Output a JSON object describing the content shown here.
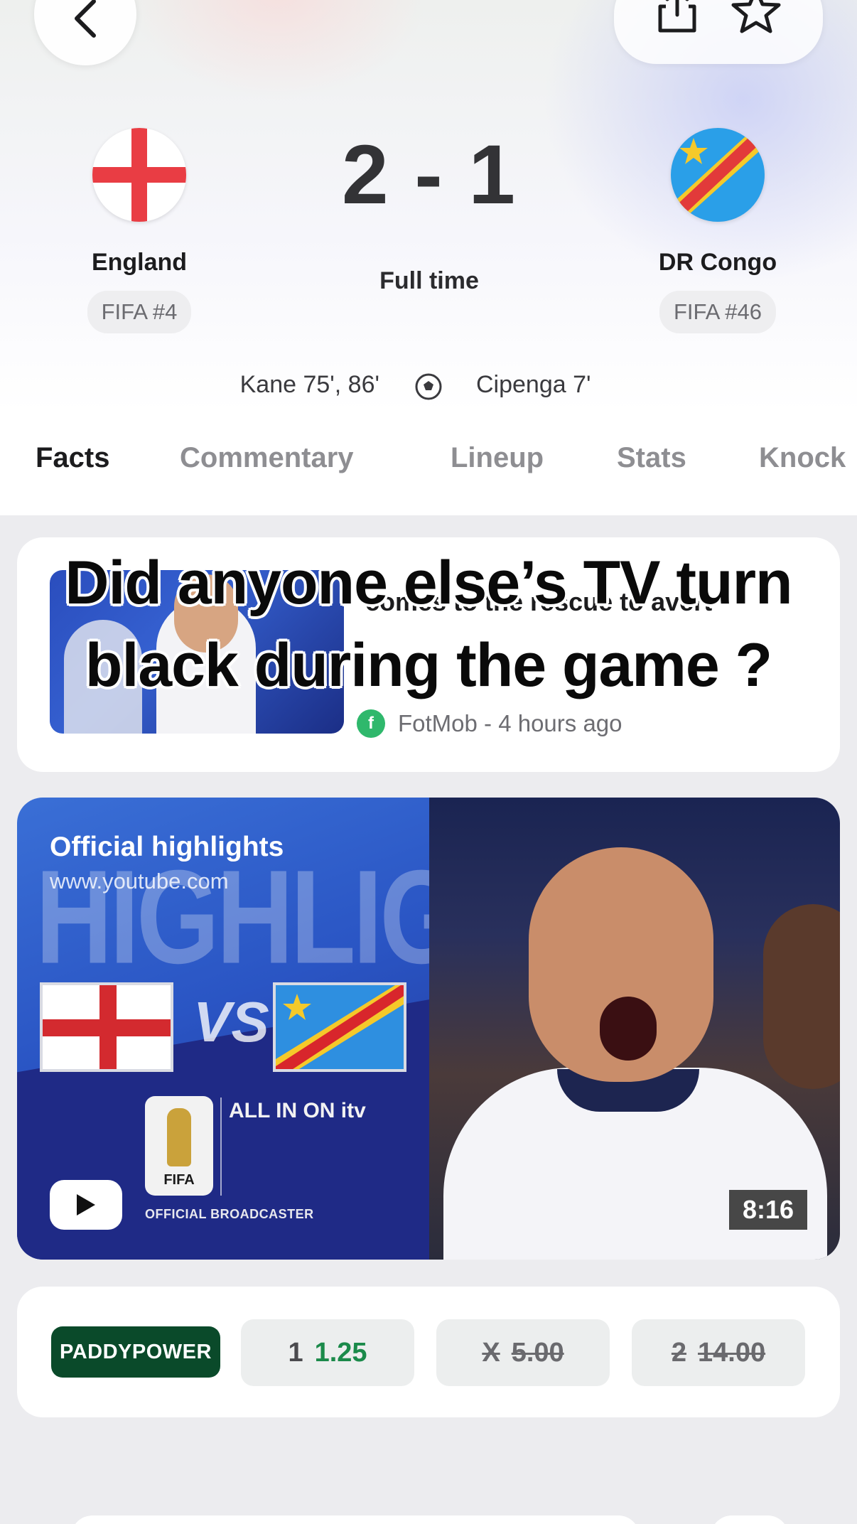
{
  "match": {
    "home": {
      "name": "England",
      "rank": "FIFA #4"
    },
    "away": {
      "name": "DR Congo",
      "rank": "FIFA #46"
    },
    "score": "2 - 1",
    "status": "Full time",
    "scorers": {
      "home": "Kane 75', 86'",
      "away": "Cipenga 7'"
    }
  },
  "tabs": [
    {
      "label": "Facts",
      "active": true
    },
    {
      "label": "Commentary"
    },
    {
      "label": "Lineup"
    },
    {
      "label": "Stats"
    },
    {
      "label": "Knock"
    }
  ],
  "overlay_caption": "Did anyone else’s TV turn black during the game ?",
  "news": {
    "title": "comes to the rescue to avert",
    "source": "FotMob - 4 hours ago"
  },
  "video": {
    "title": "Official highlights",
    "url": "www.youtube.com",
    "thumbnail_text": "HIGHLIGHTS",
    "vs_text": "VS",
    "brand_fifa": "FIFA",
    "brand_itv": "ALL IN ON itv",
    "broadcaster": "OFFICIAL BROADCASTER",
    "duration": "8:16"
  },
  "odds": {
    "bookmaker": "PADDYPOWER",
    "options": [
      {
        "label": "1",
        "value": "1.25",
        "suspended": false
      },
      {
        "label": "X",
        "value": "5.00",
        "suspended": true
      },
      {
        "label": "2",
        "value": "14.00",
        "suspended": true
      }
    ]
  },
  "colors": {
    "england_red": "#e93d44",
    "drc_blue": "#2a9fe8",
    "odds_up_green": "#1b8a4a",
    "bookmaker_green": "#0a4a2a"
  },
  "icons": [
    "back-icon",
    "share-icon",
    "star-icon",
    "football-icon",
    "fotmob-icon",
    "youtube-play-icon"
  ]
}
